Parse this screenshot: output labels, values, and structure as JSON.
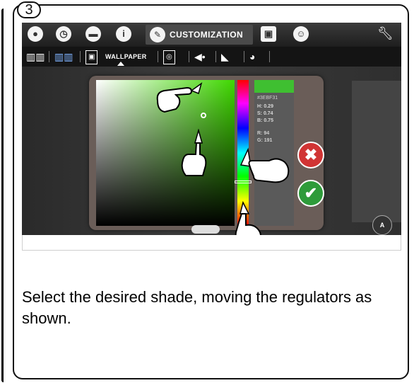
{
  "step": {
    "number": "3"
  },
  "device": {
    "topbar": {
      "active_tab_label": "CUSTOMIZATION",
      "icons": [
        "drop-icon",
        "clock-icon",
        "chat-icon",
        "info-icon",
        "pencil-icon",
        "monitor-icon",
        "user-icon",
        "wrench-icon"
      ]
    },
    "subbar": {
      "wallpaper_label": "WALLPAPER",
      "icons": [
        "book-icon",
        "book-color-icon",
        "wallpaper-icon",
        "screensaver-icon",
        "speaker-icon",
        "boot-image-icon",
        "palette-icon"
      ]
    },
    "picker": {
      "hex": "#3EBF31",
      "hue_label": "H:",
      "hue_value": "0.29",
      "sat_label": "S:",
      "sat_value": "0.74",
      "bri_label": "B:",
      "bri_value": "0.75",
      "red_label": "R:",
      "red_value": "94",
      "green_label": "G:",
      "green_value": "191",
      "swatch_color": "#3fbf31"
    }
  },
  "instruction": "Select the desired shade, moving the regulators as shown."
}
